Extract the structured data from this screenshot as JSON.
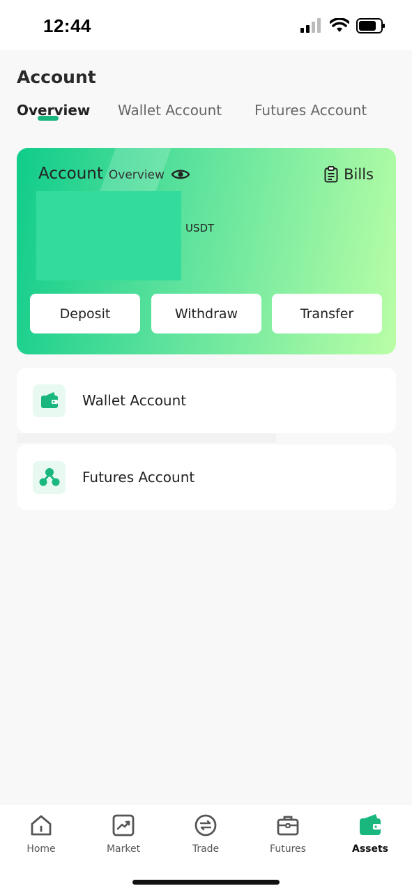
{
  "status_bar": {
    "time": "12:44"
  },
  "header": {
    "title": "Account"
  },
  "tabs": [
    {
      "label": "Overview",
      "active": true
    },
    {
      "label": "Wallet Account",
      "active": false
    },
    {
      "label": "Futures Account",
      "active": false
    }
  ],
  "overview_card": {
    "title_main": "Account",
    "title_sub": "Overview",
    "bills_label": "Bills",
    "balance_unit": "USDT",
    "actions": {
      "deposit": "Deposit",
      "withdraw": "Withdraw",
      "transfer": "Transfer"
    }
  },
  "accounts": [
    {
      "label": "Wallet Account",
      "icon": "wallet-icon"
    },
    {
      "label": "Futures Account",
      "icon": "nodes-icon"
    }
  ],
  "bottom_nav": [
    {
      "label": "Home",
      "icon": "home-icon",
      "active": false
    },
    {
      "label": "Market",
      "icon": "chart-icon",
      "active": false
    },
    {
      "label": "Trade",
      "icon": "exchange-icon",
      "active": false
    },
    {
      "label": "Futures",
      "icon": "briefcase-icon",
      "active": false
    },
    {
      "label": "Assets",
      "icon": "wallet-icon",
      "active": true
    }
  ],
  "colors": {
    "accent": "#19b77d",
    "card_gradient_start": "#10cc8a",
    "card_gradient_end": "#bafea6",
    "background": "#f8f8f8"
  }
}
